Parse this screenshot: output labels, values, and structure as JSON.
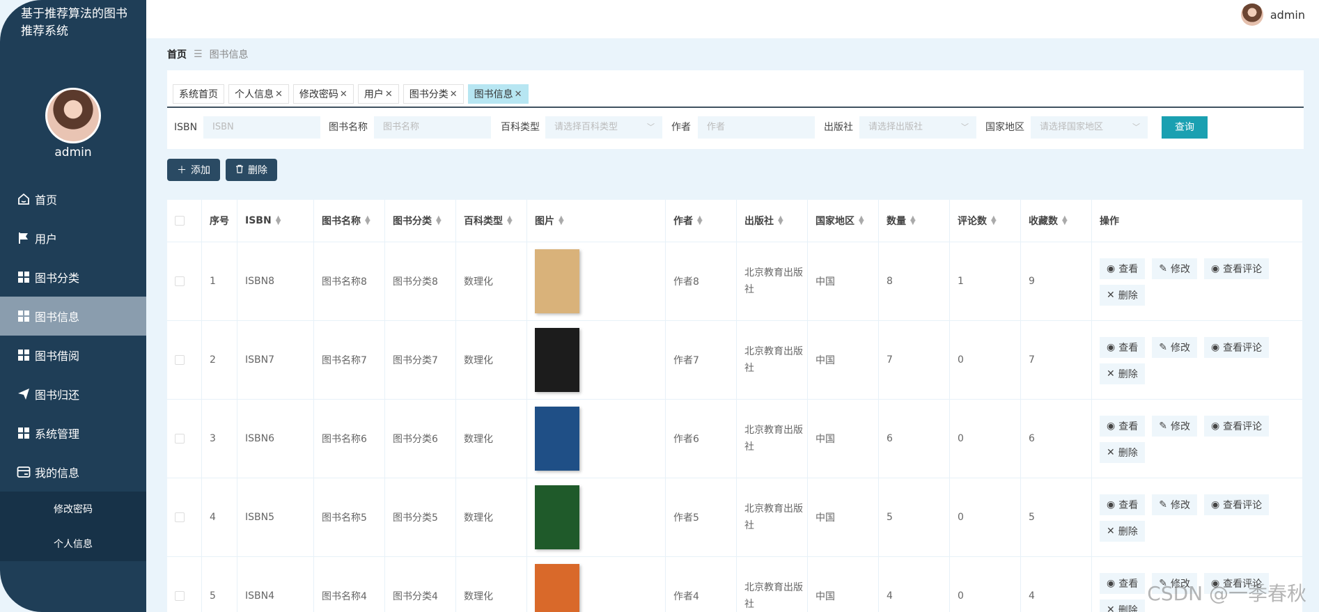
{
  "app": {
    "title": "基于推荐算法的图书推荐系统",
    "user_name": "admin"
  },
  "menu": [
    {
      "label": "首页",
      "icon": "home-icon"
    },
    {
      "label": "用户",
      "icon": "flag-icon"
    },
    {
      "label": "图书分类",
      "icon": "grid-icon"
    },
    {
      "label": "图书信息",
      "icon": "grid-icon",
      "active": true
    },
    {
      "label": "图书借阅",
      "icon": "grid-icon"
    },
    {
      "label": "图书归还",
      "icon": "send-icon"
    },
    {
      "label": "系统管理",
      "icon": "grid-icon"
    },
    {
      "label": "我的信息",
      "icon": "card-icon"
    }
  ],
  "submenu": [
    "修改密码",
    "个人信息"
  ],
  "breadcrumb": {
    "home": "首页",
    "sep": "☰",
    "current": "图书信息"
  },
  "tabs": [
    {
      "label": "系统首页",
      "closable": false
    },
    {
      "label": "个人信息",
      "closable": true
    },
    {
      "label": "修改密码",
      "closable": true
    },
    {
      "label": "用户",
      "closable": true
    },
    {
      "label": "图书分类",
      "closable": true
    },
    {
      "label": "图书信息",
      "closable": true,
      "active": true
    }
  ],
  "filters": {
    "isbn_label": "ISBN",
    "isbn_placeholder": "ISBN",
    "name_label": "图书名称",
    "name_placeholder": "图书名称",
    "type_label": "百科类型",
    "type_placeholder": "请选择百科类型",
    "author_label": "作者",
    "author_placeholder": "作者",
    "publisher_label": "出版社",
    "publisher_placeholder": "请选择出版社",
    "region_label": "国家地区",
    "region_placeholder": "请选择国家地区",
    "query_label": "查询"
  },
  "actions": {
    "add_label": "添加",
    "delete_label": "删除"
  },
  "table": {
    "headers": [
      "序号",
      "ISBN",
      "图书名称",
      "图书分类",
      "百科类型",
      "图片",
      "作者",
      "出版社",
      "国家地区",
      "数量",
      "评论数",
      "收藏数",
      "操作"
    ],
    "op_labels": {
      "view": "查看",
      "edit": "修改",
      "comments": "查看评论",
      "delete": "删除"
    },
    "rows": [
      {
        "no": "1",
        "isbn": "ISBN8",
        "name": "图书名称8",
        "category": "图书分类8",
        "type": "数理化",
        "author": "作者8",
        "publisher": "北京教育出版社",
        "region": "中国",
        "qty": "8",
        "comments": "1",
        "favs": "9",
        "cover_color": "#d9b27a"
      },
      {
        "no": "2",
        "isbn": "ISBN7",
        "name": "图书名称7",
        "category": "图书分类7",
        "type": "数理化",
        "author": "作者7",
        "publisher": "北京教育出版社",
        "region": "中国",
        "qty": "7",
        "comments": "0",
        "favs": "7",
        "cover_color": "#1c1c1c"
      },
      {
        "no": "3",
        "isbn": "ISBN6",
        "name": "图书名称6",
        "category": "图书分类6",
        "type": "数理化",
        "author": "作者6",
        "publisher": "北京教育出版社",
        "region": "中国",
        "qty": "6",
        "comments": "0",
        "favs": "6",
        "cover_color": "#1f4f86"
      },
      {
        "no": "4",
        "isbn": "ISBN5",
        "name": "图书名称5",
        "category": "图书分类5",
        "type": "数理化",
        "author": "作者5",
        "publisher": "北京教育出版社",
        "region": "中国",
        "qty": "5",
        "comments": "0",
        "favs": "5",
        "cover_color": "#1f5a2a"
      },
      {
        "no": "5",
        "isbn": "ISBN4",
        "name": "图书名称4",
        "category": "图书分类4",
        "type": "数理化",
        "author": "作者4",
        "publisher": "北京教育出版社",
        "region": "中国",
        "qty": "4",
        "comments": "0",
        "favs": "4",
        "cover_color": "#d9692a"
      }
    ]
  },
  "watermark": "CSDN @一季春秋",
  "colors": {
    "sidebar": "#1f3e57",
    "active_menu": "#8a9dae",
    "query_button": "#1aa0b1",
    "active_tab": "#b7e6f2"
  }
}
